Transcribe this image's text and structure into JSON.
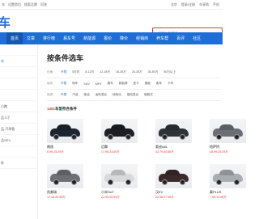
{
  "topbar": {
    "links": [
      "车",
      "设置首页",
      "搜索品牌",
      "问答"
    ],
    "right": [
      "北京",
      "登录/注册",
      "车享购",
      "手机"
    ]
  },
  "logo": "车",
  "search": {
    "placeholder": "请输入关键词"
  },
  "nav": {
    "items": [
      "首页",
      "文章",
      "排行榜",
      "易车号",
      "新能源",
      "报价",
      "降价",
      "经销商",
      "养车帮",
      "百评",
      "社区"
    ]
  },
  "sidebar": {
    "items": [
      "",
      "车",
      "",
      "",
      "",
      "小跑",
      "品-5了",
      "品-汽季智",
      "品SEV",
      "",
      "轩"
    ]
  },
  "main": {
    "title": "按条件选车",
    "filters": [
      {
        "label": "价格",
        "options": [
          "不限",
          "5万内",
          "8-12万",
          "12-18万",
          "18-25万",
          "25-35万",
          "35-50万",
          "50万以上"
        ]
      },
      {
        "label": "级别",
        "options": [
          "不限",
          "轿车",
          "SUV",
          "MPV",
          "跑车",
          "新能源",
          "皮卡",
          "微面",
          "客车",
          "卡车"
        ]
      },
      {
        "label": "能源",
        "options": [
          "不限",
          "汽油",
          "柴油",
          "油电混合",
          "纯电动",
          "插电混合",
          "增程式"
        ]
      }
    ],
    "count_number": "1451",
    "count_text": "车型符合条件",
    "cars": [
      {
        "name": "朗逸",
        "price": "8.99-15.29万",
        "color": "#1c2530"
      },
      {
        "name": "迈腾",
        "price": "17.99-23.69万",
        "color": "#1d1f24"
      },
      {
        "name": "奥迪A6L",
        "price": "42.79-65.68万",
        "color": "#2f3338"
      },
      {
        "name": "帕萨特",
        "price": "18.99-25.29万",
        "color": "#6b6f75"
      },
      {
        "name": "凯美瑞",
        "price": "17.18-20.98万",
        "color": "#6c7076"
      },
      {
        "name": "小米SU7",
        "price": "21.59-29.99万",
        "color": "#d8d9db"
      },
      {
        "name": "汉EV",
        "price": "20.98-27.98万",
        "color": "#3b2a2a"
      },
      {
        "name": "秦PLUS",
        "price": "7.98-13.98万",
        "color": "#a8adb4"
      }
    ]
  }
}
